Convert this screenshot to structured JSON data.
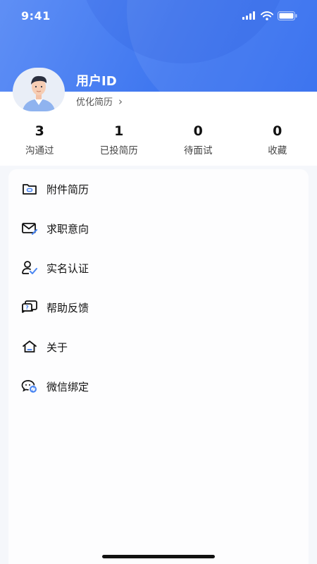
{
  "status_bar": {
    "time": "9:41",
    "icons": [
      "signal-icon",
      "wifi-icon",
      "battery-icon"
    ]
  },
  "profile": {
    "user_id_label": "用户ID",
    "optimize_resume_label": "优化简历",
    "avatar_icon": "avatar-illustration"
  },
  "stats": [
    {
      "value": "3",
      "label": "沟通过"
    },
    {
      "value": "1",
      "label": "已投简历"
    },
    {
      "value": "0",
      "label": "待面试"
    },
    {
      "value": "0",
      "label": "收藏"
    }
  ],
  "menu": [
    {
      "label": "附件简历",
      "icon": "folder-icon"
    },
    {
      "label": "求职意向",
      "icon": "mail-icon"
    },
    {
      "label": "实名认证",
      "icon": "user-verify-icon"
    },
    {
      "label": "帮助反馈",
      "icon": "help-feedback-icon"
    },
    {
      "label": "关于",
      "icon": "home-icon"
    },
    {
      "label": "微信绑定",
      "icon": "wechat-icon"
    }
  ],
  "colors": {
    "header_gradient_start": "#5f8ff5",
    "header_gradient_end": "#2f6aee",
    "accent": "#3f77f0",
    "icon_accent": "#4b86f2"
  }
}
